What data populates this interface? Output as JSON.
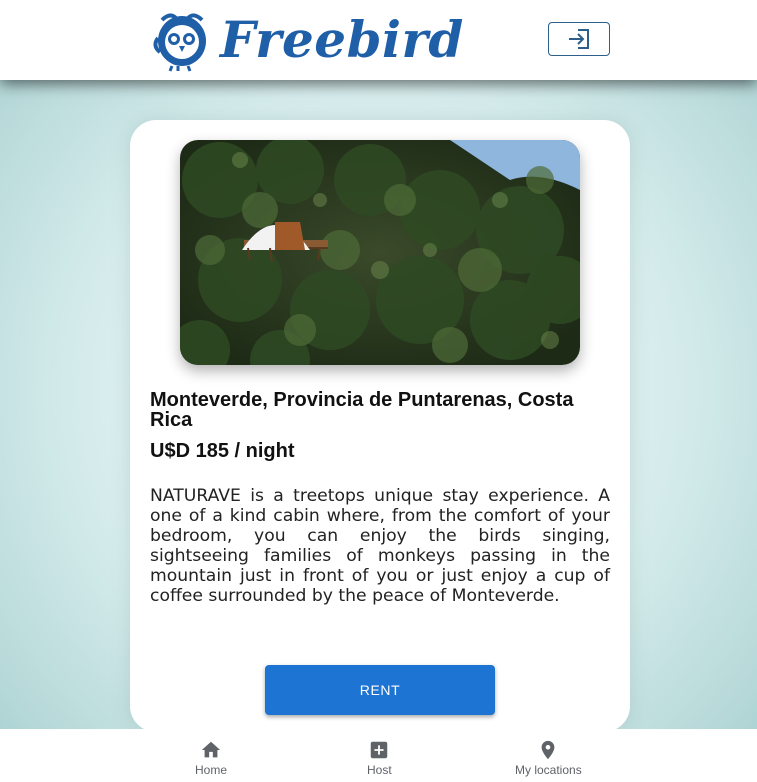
{
  "app": {
    "brand": "Freebird"
  },
  "header": {
    "login_icon": "login-icon"
  },
  "listing": {
    "image_icon": "treetop-dome-photo",
    "location": "Monteverde, Provincia de Puntarenas, Costa Rica",
    "price": "U$D 185 / night",
    "description": "NATURAVE is a treetops unique stay experience. A one of a kind cabin where, from the comfort of your bedroom, you can enjoy the birds singing, sightseeing families of monkeys passing in the mountain just in front of you or just enjoy a cup of coffee surrounded by the peace of Monteverde.",
    "rent_label": "RENT"
  },
  "bottom_nav": {
    "items": [
      {
        "label": "Home",
        "icon": "home-icon"
      },
      {
        "label": "Host",
        "icon": "add-box-icon"
      },
      {
        "label": "My locations",
        "icon": "location-pin-icon"
      }
    ]
  },
  "colors": {
    "brand": "#1f5fa8",
    "primary_button": "#1e74d2",
    "background": "#d6ecec"
  }
}
